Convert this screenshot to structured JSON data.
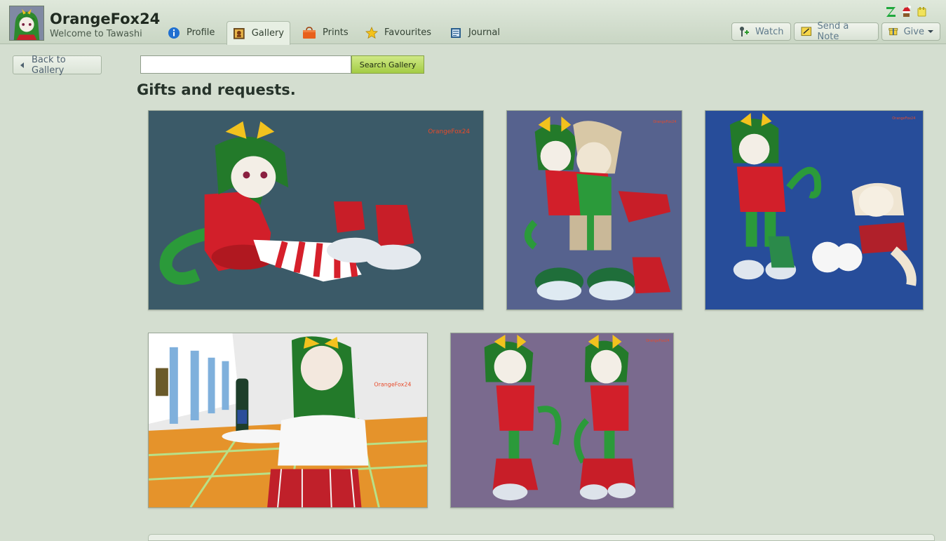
{
  "header": {
    "username": "OrangeFox24",
    "welcome": "Welcome to Tawashi",
    "tabs": [
      {
        "label": "Profile",
        "icon": "info-icon",
        "active": false
      },
      {
        "label": "Gallery",
        "icon": "gallery-icon",
        "active": true
      },
      {
        "label": "Prints",
        "icon": "shopping-bag-icon",
        "active": false
      },
      {
        "label": "Favourites",
        "icon": "star-icon",
        "active": false
      },
      {
        "label": "Journal",
        "icon": "journal-icon",
        "active": false
      }
    ],
    "actions": [
      {
        "label": "Watch",
        "icon": "watch-icon"
      },
      {
        "label": "Send a Note",
        "icon": "note-icon"
      },
      {
        "label": "Give",
        "icon": "gift-icon",
        "has_dropdown": true
      }
    ],
    "status_icons": [
      "premium-z-icon",
      "gift-santa-icon",
      "badge-icon"
    ]
  },
  "nav": {
    "back_label": "Back to Gallery"
  },
  "search": {
    "value": "",
    "placeholder": "",
    "button_label": "Search Gallery"
  },
  "gallery": {
    "title": "Gifts and requests.",
    "watermark": "OrangeFox24",
    "items": [
      {
        "name": "thumbnail-1",
        "bg": "#3b5a68"
      },
      {
        "name": "thumbnail-2",
        "bg": "#56628e"
      },
      {
        "name": "thumbnail-3",
        "bg": "#274d9a"
      },
      {
        "name": "thumbnail-4",
        "bg": "#eaeaea"
      },
      {
        "name": "thumbnail-5",
        "bg": "#7a6a8e"
      }
    ]
  },
  "colors": {
    "page_bg": "#d4ded0",
    "accent_green": "#a4cc44",
    "link_blue": "#5f7a8b"
  }
}
